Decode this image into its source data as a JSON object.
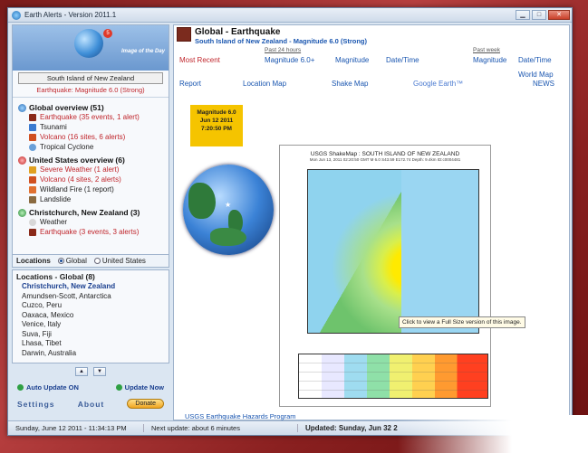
{
  "window": {
    "title": "Earth Alerts - Version 2011.1"
  },
  "sidebar": {
    "image_of_day_label": "Image of the Day",
    "badge": "5",
    "location": "South Island of New Zealand",
    "location_alert": "Earthquake: Magnitude 6.0 (Strong)",
    "groups": [
      {
        "title": "Global overview (51)",
        "items": [
          "Earthquake (35 events, 1 alert)",
          "Tsunami",
          "Volcano (16 sites, 6 alerts)",
          "Tropical Cyclone"
        ]
      },
      {
        "title": "United States overview (6)",
        "items": [
          "Severe Weather (1 alert)",
          "Volcano (4 sites, 2 alerts)",
          "Wildland Fire (1 report)",
          "Landslide"
        ]
      },
      {
        "title": "Christchurch, New Zealand (3)",
        "items": [
          "Weather",
          "Earthquake (3 events, 3 alerts)"
        ]
      }
    ],
    "locations_label": "Locations",
    "radio_global": "Global",
    "radio_us": "United States",
    "locations_head": "Locations - Global (8)",
    "locations": [
      "Christchurch, New Zealand",
      "Amundsen-Scott, Antarctica",
      "Cuzco, Peru",
      "Oaxaca, Mexico",
      "Venice, Italy",
      "Suva, Fiji",
      "Lhasa, Tibet",
      "Darwin, Australia"
    ],
    "auto_update": "Auto Update ON",
    "update_now": "Update Now",
    "settings": "Settings",
    "about": "About",
    "donate": "Donate"
  },
  "main": {
    "title": "Global - Earthquake",
    "subtitle": "South Island of New Zealand - Magnitude 6.0 (Strong)",
    "most_recent": "Most Recent",
    "past24": "Past 24 hours",
    "mag60plus": "Magnitude 6.0+",
    "magnitude": "Magnitude",
    "datetime": "Date/Time",
    "past_week": "Past week",
    "magnitude_w": "Magnitude",
    "datetime_w": "Date/Time",
    "report": "Report",
    "location_map": "Location Map",
    "shake_map": "Shake Map",
    "google_earth": "Google Earth™",
    "world_map": "World Map",
    "news": "NEWS",
    "mag_box": {
      "line1": "Magnitude 6.0",
      "line2": "Jun 12 2011",
      "line3": "7:20:50 PM"
    },
    "shakemap_title": "USGS ShakeMap : SOUTH ISLAND OF NEW ZEALAND",
    "shakemap_sub": "Mon Jun 13, 2011 02:20:50 GMT  M 6.0  S43.59 E172.74  Depth: 9.4km  ID:c0004481",
    "tooltip": "Click to view a Full Size version of this image.",
    "usgs_link": "USGS Earthquake Hazards Program"
  },
  "statusbar": {
    "date": "Sunday, June 12 2011 - 11:34:13 PM",
    "next_update": "Next update: about 6 minutes",
    "updated": "Updated: Sunday, Jun 32 2"
  }
}
